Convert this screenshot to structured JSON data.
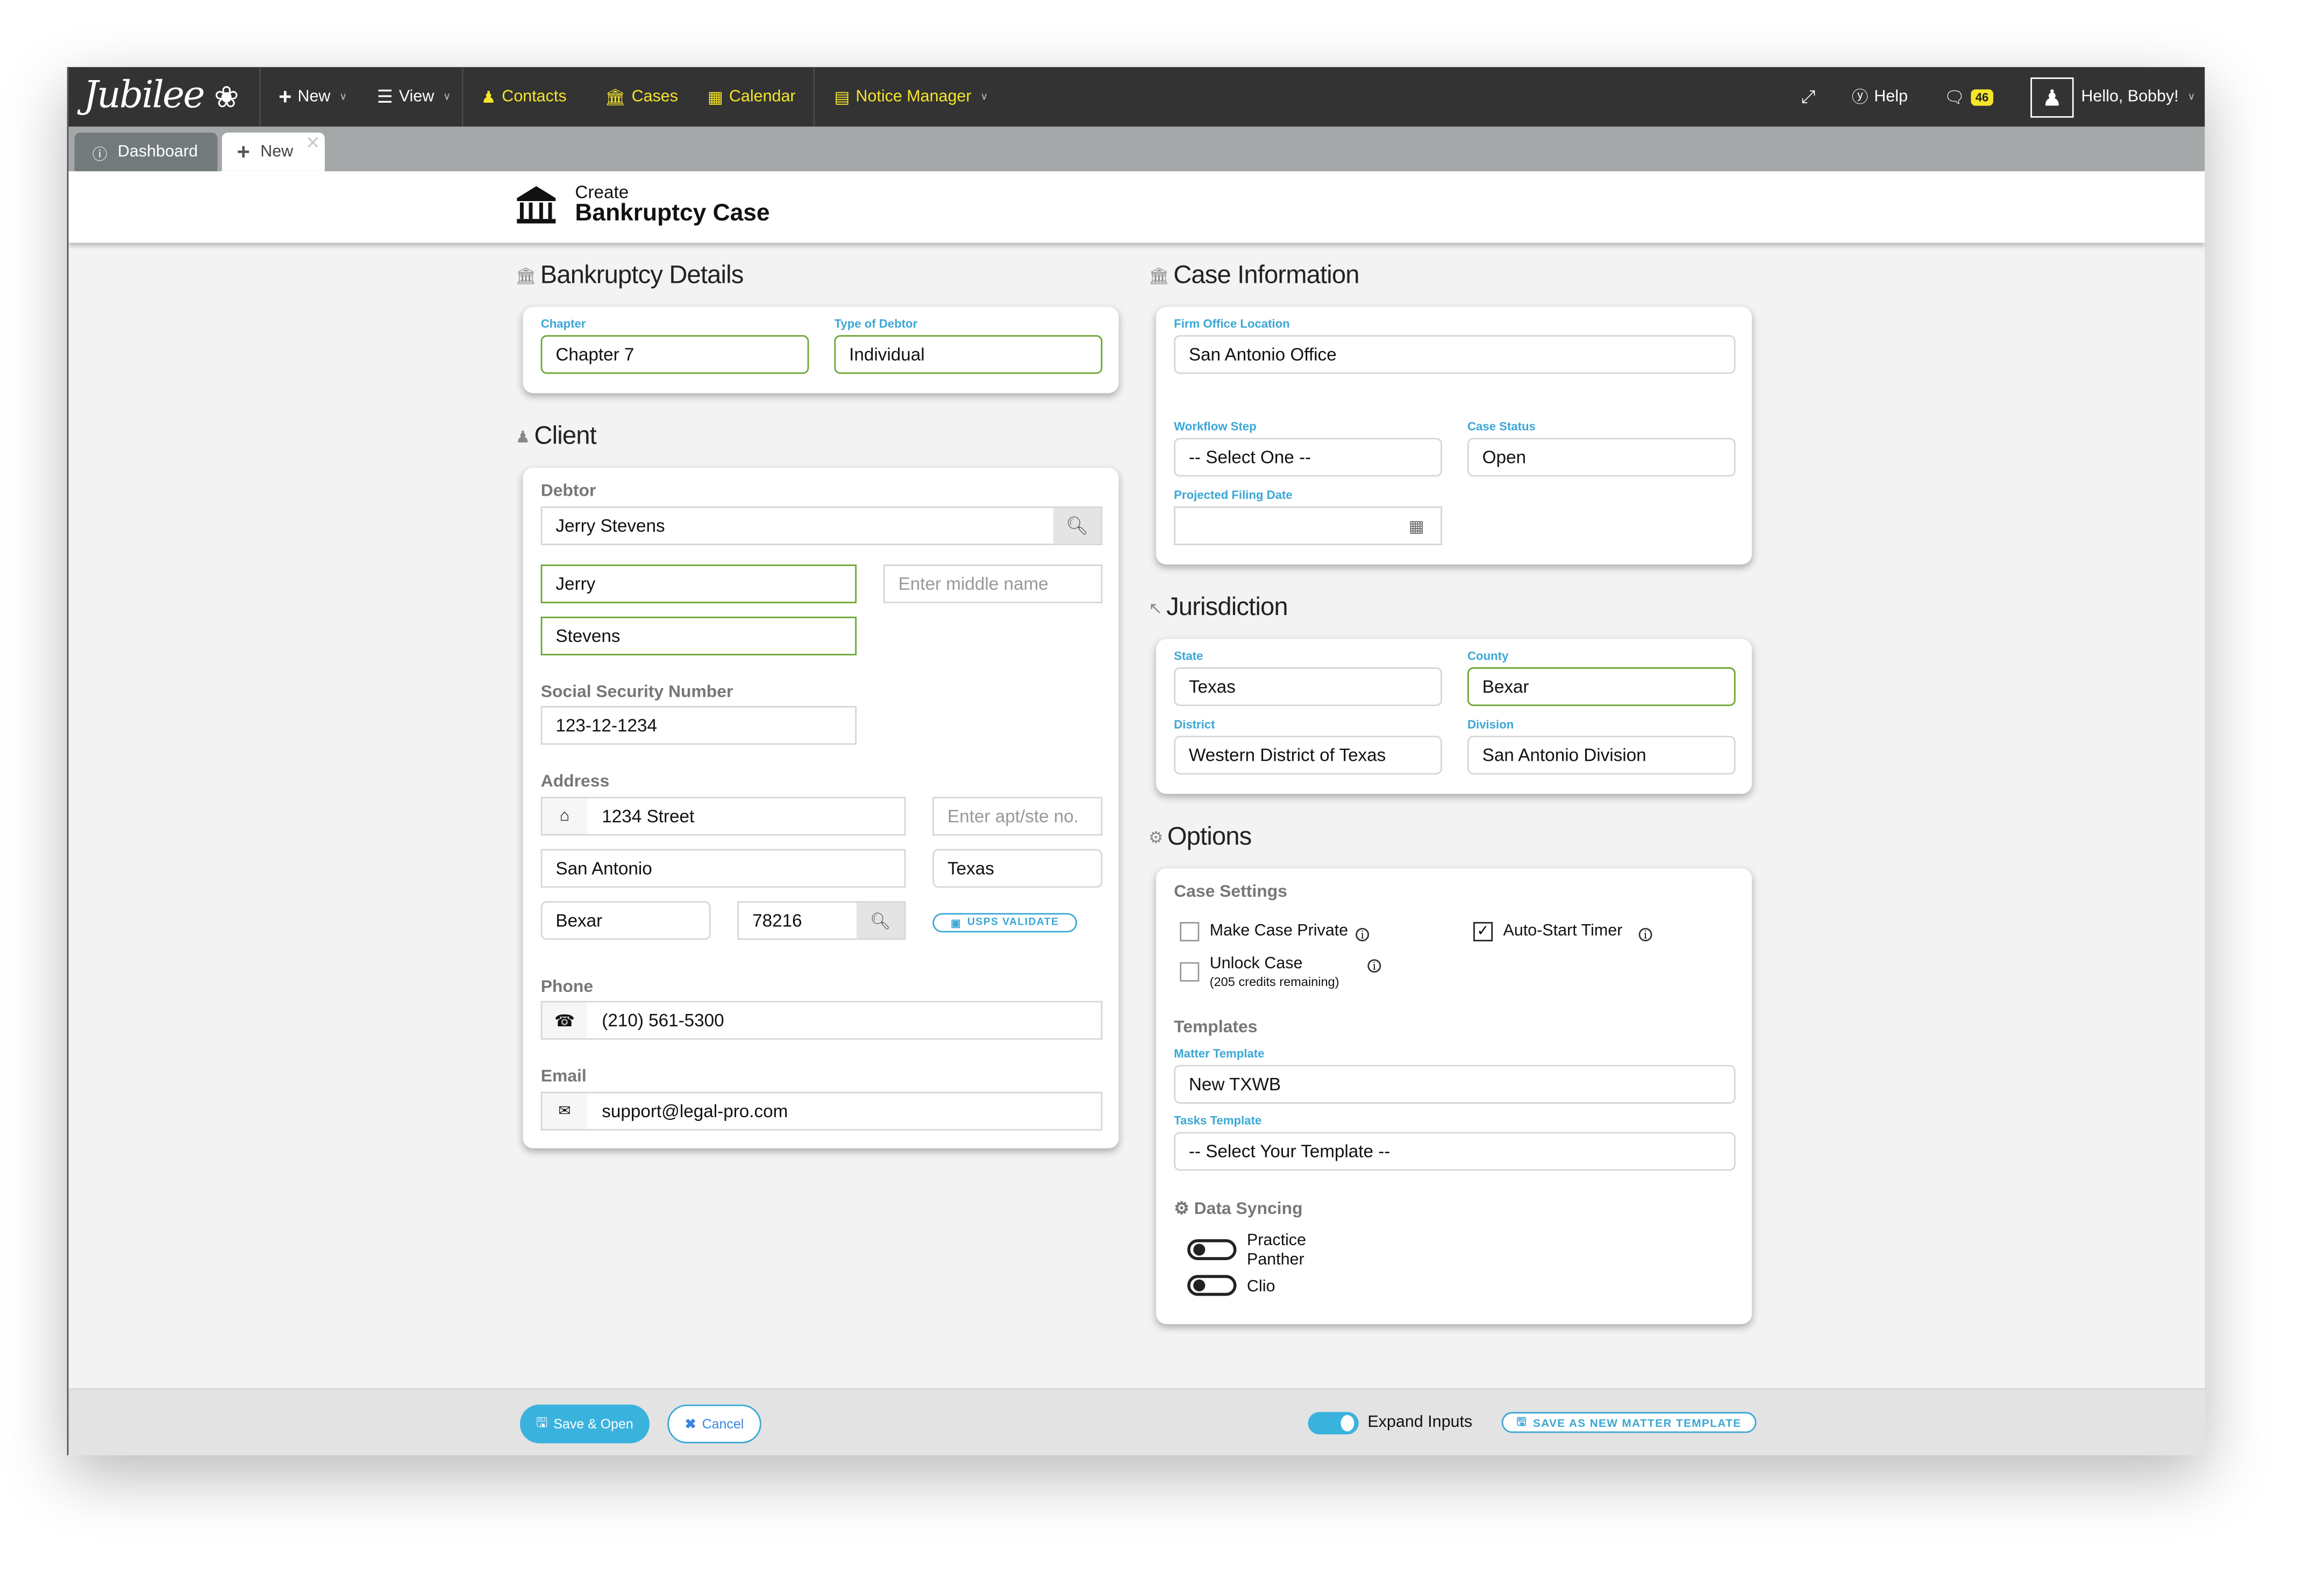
{
  "navbar": {
    "logo": "Jubilee",
    "new_label": "New",
    "view_label": "View",
    "contacts_label": "Contacts",
    "cases_label": "Cases",
    "calendar_label": "Calendar",
    "notice_manager_label": "Notice Manager",
    "help_label": "Help",
    "messages_count": "46",
    "greeting": "Hello, Bobby!",
    "accent_color": "#f5e52b"
  },
  "tabs": [
    {
      "label": "Dashboard",
      "icon": "dashboard-icon"
    },
    {
      "label": "New",
      "icon": "plus-icon",
      "active": true
    }
  ],
  "page_header": {
    "small": "Create",
    "title": "Bankruptcy Case"
  },
  "bankruptcy_details": {
    "title": "Bankruptcy Details",
    "chapter_label": "Chapter",
    "chapter_value": "Chapter 7",
    "debtor_type_label": "Type of Debtor",
    "debtor_type_value": "Individual"
  },
  "client": {
    "title": "Client",
    "debtor_label": "Debtor",
    "debtor_search_value": "Jerry Stevens",
    "first_name": "Jerry",
    "middle_name_placeholder": "Enter middle name",
    "last_name": "Stevens",
    "ssn_label": "Social Security Number",
    "ssn_value": "123-12-1234",
    "address_label": "Address",
    "street": "1234 Street",
    "apt_placeholder": "Enter apt/ste no.",
    "city": "San Antonio",
    "state": "Texas",
    "county": "Bexar",
    "zip": "78216",
    "usps_label": "USPS VALIDATE",
    "phone_label": "Phone",
    "phone_value": "(210) 561-5300",
    "email_label": "Email",
    "email_value": "support@legal-pro.com"
  },
  "case_information": {
    "title": "Case Information",
    "office_label": "Firm Office Location",
    "office_value": "San Antonio Office",
    "workflow_label": "Workflow Step",
    "workflow_value": "-- Select One --",
    "status_label": "Case Status",
    "status_value": "Open",
    "filing_date_label": "Projected Filing Date",
    "filing_date_value": ""
  },
  "jurisdiction": {
    "title": "Jurisdiction",
    "state_label": "State",
    "state_value": "Texas",
    "county_label": "County",
    "county_value": "Bexar",
    "district_label": "District",
    "district_value": "Western District of Texas",
    "division_label": "Division",
    "division_value": "San Antonio Division"
  },
  "options": {
    "title": "Options",
    "case_settings_label": "Case Settings",
    "make_private_label": "Make Case Private",
    "make_private_checked": false,
    "auto_timer_label": "Auto-Start Timer",
    "auto_timer_checked": true,
    "unlock_label": "Unlock Case",
    "unlock_sub": "(205 credits remaining)",
    "unlock_checked": false,
    "templates_label": "Templates",
    "matter_template_label": "Matter Template",
    "matter_template_value": "New TXWB",
    "tasks_template_label": "Tasks Template",
    "tasks_template_value": "-- Select Your Template --",
    "data_syncing_label": "Data Syncing",
    "sync_practice_panther_line1": "Practice",
    "sync_practice_panther_line2": "Panther",
    "sync_practice_panther_on": false,
    "sync_clio": "Clio",
    "sync_clio_on": false
  },
  "footer": {
    "save_open_label": "Save & Open",
    "cancel_label": "Cancel",
    "expand_inputs_label": "Expand Inputs",
    "expand_inputs_on": true,
    "save_template_label": "SAVE AS NEW MATTER TEMPLATE",
    "primary_color": "#3ab2de"
  }
}
